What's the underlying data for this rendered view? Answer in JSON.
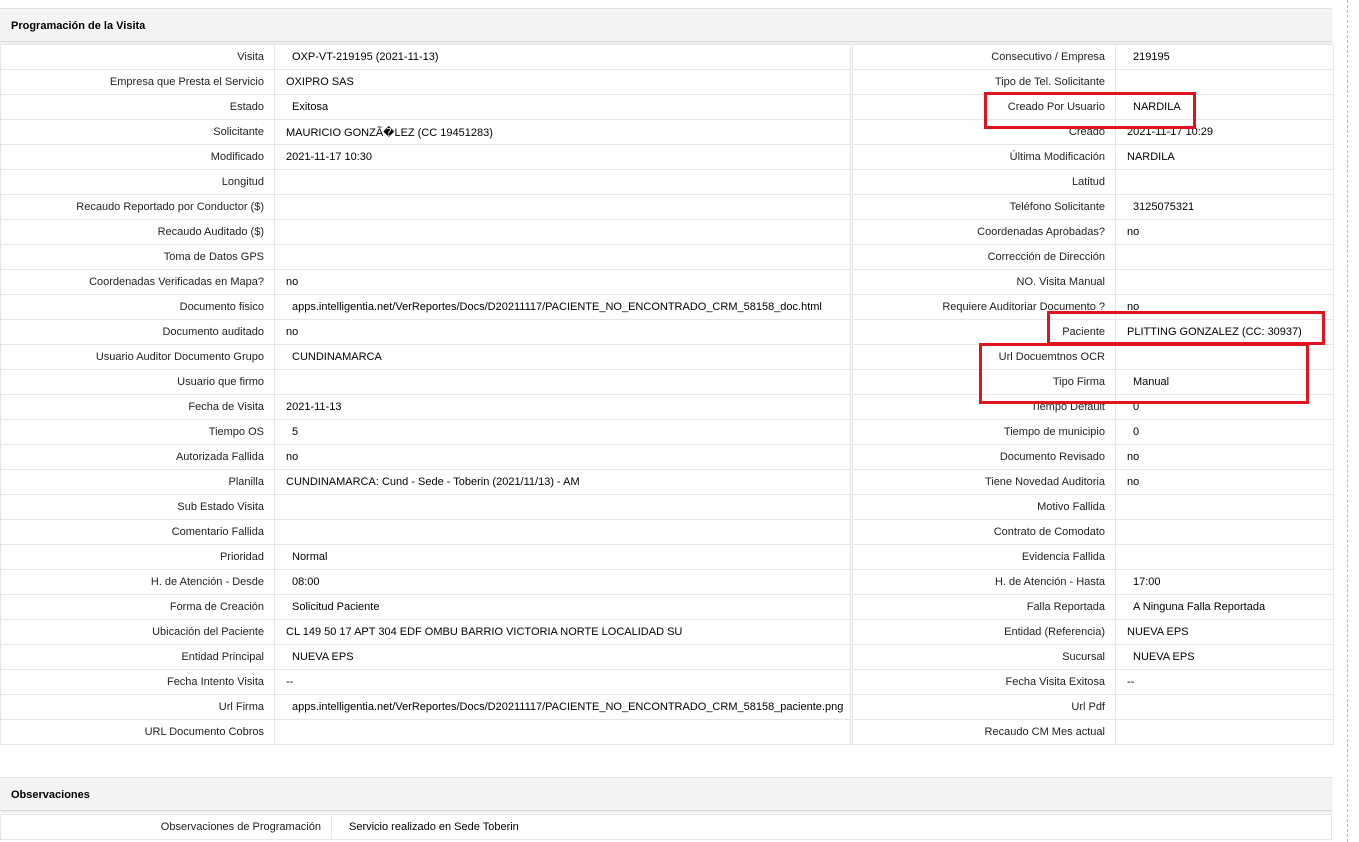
{
  "section_title": "Programación de la Visita",
  "observations_title": "Observaciones",
  "rows": [
    {
      "l1": "Visita",
      "v1": "OXP-VT-219195 (2021-11-13)",
      "l2": "Consecutivo / Empresa",
      "v2": "219195"
    },
    {
      "l1": "Empresa que Presta el Servicio",
      "v1": "OXIPRO SAS",
      "l2": "Tipo de Tel. Solicitante",
      "v2": ""
    },
    {
      "l1": "Estado",
      "v1": "Exitosa",
      "l2": "Creado Por Usuario",
      "v2": "NARDILA"
    },
    {
      "l1": "Solicitante",
      "v1": "MAURICIO GONZÃ�LEZ (CC 19451283)",
      "l2": "Creado",
      "v2": "2021-11-17 10:29"
    },
    {
      "l1": "Modificado",
      "v1": "2021-11-17 10:30",
      "l2": "Última Modificación",
      "v2": "NARDILA"
    },
    {
      "l1": "Longitud",
      "v1": "",
      "l2": "Latitud",
      "v2": ""
    },
    {
      "l1": "Recaudo Reportado por Conductor ($)",
      "v1": "",
      "l2": "Teléfono Solicitante",
      "v2": "3125075321"
    },
    {
      "l1": "Recaudo Auditado ($)",
      "v1": "",
      "l2": "Coordenadas Aprobadas?",
      "v2": "no"
    },
    {
      "l1": "Toma de Datos GPS",
      "v1": "",
      "l2": "Corrección de Dirección",
      "v2": ""
    },
    {
      "l1": "Coordenadas Verificadas en Mapa?",
      "v1": "no",
      "l2": "NO. Visita Manual",
      "v2": ""
    },
    {
      "l1": "Documento fisico",
      "v1": "apps.intelligentia.net/VerReportes/Docs/D20211117/PACIENTE_NO_ENCONTRADO_CRM_58158_doc.html",
      "l2": "Requiere Auditoriar Documento ?",
      "v2": "no"
    },
    {
      "l1": "Documento auditado",
      "v1": "no",
      "l2": "Paciente",
      "v2": "PLITTING GONZALEZ (CC: 30937)"
    },
    {
      "l1": "Usuario Auditor Documento Grupo",
      "v1": "CUNDINAMARCA",
      "l2": "Url Docuemtnos OCR",
      "v2": ""
    },
    {
      "l1": "Usuario que firmo",
      "v1": "",
      "l2": "Tipo Firma",
      "v2": "Manual"
    },
    {
      "l1": "Fecha de Visita",
      "v1": "2021-11-13",
      "l2": "Tiempo Default",
      "v2": "0"
    },
    {
      "l1": "Tiempo OS",
      "v1": "5",
      "l2": "Tiempo de municipio",
      "v2": "0"
    },
    {
      "l1": "Autorizada Fallida",
      "v1": "no",
      "l2": "Documento Revisado",
      "v2": "no"
    },
    {
      "l1": "Planilla",
      "v1": "CUNDINAMARCA: Cund - Sede - Toberin (2021/11/13) - AM",
      "l2": "Tiene Novedad Auditoria",
      "v2": "no"
    },
    {
      "l1": "Sub Estado Visita",
      "v1": "",
      "l2": "Motivo Fallida",
      "v2": ""
    },
    {
      "l1": "Comentario Fallida",
      "v1": "",
      "l2": "Contrato de Comodato",
      "v2": ""
    },
    {
      "l1": "Prioridad",
      "v1": "Normal",
      "l2": "Evidencia Fallida",
      "v2": ""
    },
    {
      "l1": "H. de Atención - Desde",
      "v1": "08:00",
      "l2": "H. de Atención - Hasta",
      "v2": "17:00"
    },
    {
      "l1": "Forma de Creación",
      "v1": "Solicitud Paciente",
      "l2": "Falla Reportada",
      "v2": "A Ninguna Falla Reportada"
    },
    {
      "l1": "Ubicación del Paciente",
      "v1": "CL 149 50 17 APT 304 EDF OMBU BARRIO VICTORIA NORTE LOCALIDAD SU",
      "l2": "Entidad (Referencia)",
      "v2": "NUEVA EPS"
    },
    {
      "l1": "Entidad Principal",
      "v1": "NUEVA EPS",
      "l2": "Sucursal",
      "v2": "NUEVA EPS"
    },
    {
      "l1": "Fecha Intento Visita",
      "v1": "--",
      "l2": "Fecha Visita Exitosa",
      "v2": "--"
    },
    {
      "l1": "Url Firma",
      "v1": "apps.intelligentia.net/VerReportes/Docs/D20211117/PACIENTE_NO_ENCONTRADO_CRM_58158_paciente.png",
      "l2": "Url Pdf",
      "v2": ""
    },
    {
      "l1": "URL Documento Cobros",
      "v1": "",
      "l2": "Recaudo CM Mes actual",
      "v2": ""
    }
  ],
  "observations": {
    "label": "Observaciones de Programación",
    "value": "Servicio realizado en Sede Toberin"
  },
  "highlight_color": "#e0141e"
}
